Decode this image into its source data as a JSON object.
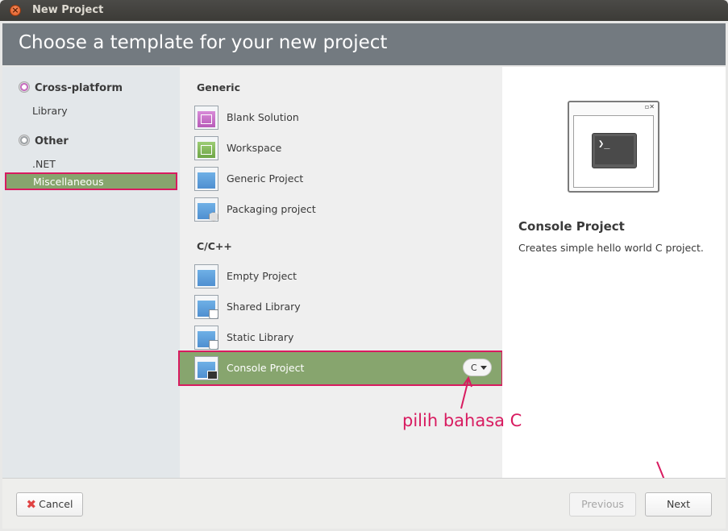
{
  "window": {
    "title": "New Project"
  },
  "header": {
    "title": "Choose a template for your new project"
  },
  "sidebar": {
    "categories": [
      {
        "label": "Cross-platform",
        "items": [
          "Library"
        ]
      },
      {
        "label": "Other",
        "items": [
          ".NET",
          "Miscellaneous"
        ]
      }
    ],
    "selected": "Miscellaneous"
  },
  "templates": {
    "sections": [
      {
        "label": "Generic",
        "items": [
          "Blank Solution",
          "Workspace",
          "Generic Project",
          "Packaging project"
        ]
      },
      {
        "label": "C/C++",
        "items": [
          "Empty Project",
          "Shared Library",
          "Static Library",
          "Console Project"
        ]
      }
    ],
    "selected": "Console Project",
    "language": "C"
  },
  "preview": {
    "icon_glyph": "❯_",
    "title": "Console Project",
    "description": "Creates simple hello world C project."
  },
  "annotation": {
    "text": "pilih bahasa C",
    "color": "#d81b60"
  },
  "footer": {
    "cancel": "Cancel",
    "previous": "Previous",
    "next": "Next"
  },
  "colors": {
    "selection": "#87a56e",
    "highlight_border": "#d81b60",
    "banner": "#737a80"
  }
}
